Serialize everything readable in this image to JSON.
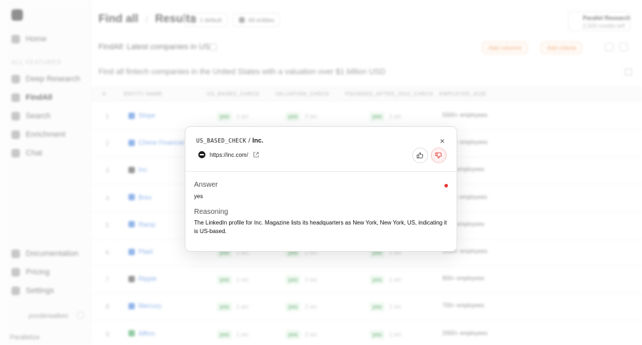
{
  "sidebar": {
    "items_top": [
      {
        "label": "Home"
      }
    ],
    "section_label": "ALL FEATURES",
    "items": [
      {
        "label": "Deep Research"
      },
      {
        "label": "FindAll"
      },
      {
        "label": "Search"
      },
      {
        "label": "Enrichment"
      },
      {
        "label": "Chat"
      }
    ],
    "bottom_items": [
      {
        "label": "Documentation"
      },
      {
        "label": "Pricing"
      },
      {
        "label": "Settings"
      }
    ],
    "user": "ponderwalken",
    "workspace": "Parallelize"
  },
  "header": {
    "breadcrumb_root": "Find all",
    "breadcrumb_separator": "/",
    "breadcrumb_current": "Results",
    "chip_1": "1 default",
    "chip_2": "All entities",
    "credits_title": "Parallel Research",
    "credits_subtitle": "2,500 credits left"
  },
  "toolbar": {
    "subtitle": "FindAll: Latest companies in US",
    "btn_1": "Add columns",
    "btn_2": "Add criteria"
  },
  "query": "Find all fintech companies in the United States with a valuation over $1 billion USD",
  "table": {
    "headers": [
      "#",
      "ENTITY NAME",
      "US_BASED_CHECK",
      "VALUATION_CHECK",
      "FOUNDED_AFTER_2010_CHECK",
      "EMPLOYEE_SIZE"
    ],
    "rows": [
      {
        "num": "1",
        "entity": "Stripe",
        "c1": "yes",
        "c1n": "1 src",
        "c2": "yes",
        "c2n": "2 src",
        "c3": "yes",
        "c3n": "1 src",
        "size": "5000+ employees"
      },
      {
        "num": "2",
        "entity": "Chime Financial",
        "c1": "yes",
        "c1n": "1 src",
        "c2": "yes",
        "c2n": "2 src",
        "c3": "yes",
        "c3n": "1 src",
        "size": "1200+ employees"
      },
      {
        "num": "3",
        "entity": "Inc.",
        "c1": "yes",
        "c1n": "1 src",
        "c2": "yes",
        "c2n": "1 src",
        "c3": "yes",
        "c3n": "1 src",
        "size": "400+ employees"
      },
      {
        "num": "4",
        "entity": "Brex",
        "c1": "yes",
        "c1n": "1 src",
        "c2": "yes",
        "c2n": "2 src",
        "c3": "yes",
        "c3n": "1 src",
        "size": "1100+ employees"
      },
      {
        "num": "5",
        "entity": "Ramp",
        "c1": "yes",
        "c1n": "1 src",
        "c2": "yes",
        "c2n": "2 src",
        "c3": "yes",
        "c3n": "1 src",
        "size": "800+ employees"
      },
      {
        "num": "6",
        "entity": "Plaid",
        "c1": "yes",
        "c1n": "1 src",
        "c2": "yes",
        "c2n": "2 src",
        "c3": "yes",
        "c3n": "1 src",
        "size": "1000+ employees"
      },
      {
        "num": "7",
        "entity": "Ripple",
        "c1": "yes",
        "c1n": "1 src",
        "c2": "yes",
        "c2n": "2 src",
        "c3": "yes",
        "c3n": "1 src",
        "size": "900+ employees"
      },
      {
        "num": "8",
        "entity": "Mercury",
        "c1": "yes",
        "c1n": "1 src",
        "c2": "yes",
        "c2n": "2 src",
        "c3": "yes",
        "c3n": "1 src",
        "size": "700+ employees"
      },
      {
        "num": "9",
        "entity": "Affirm",
        "c1": "yes",
        "c1n": "1 src",
        "c2": "yes",
        "c2n": "2 src",
        "c3": "yes",
        "c3n": "1 src",
        "size": "2000+ employees"
      }
    ]
  },
  "modal": {
    "field": "US_BASED_CHECK",
    "separator": "/",
    "entity": "Inc.",
    "url": "https://inc.com/",
    "close_icon": "×",
    "answer_label": "Answer",
    "answer_value": "yes",
    "reasoning_label": "Reasoning",
    "reasoning_text": "The LinkedIn profile for Inc. Magazine lists its headquarters as New York, New York, US, indicating it is US-based."
  },
  "colors": {
    "accent_red": "#e53935",
    "link_blue": "#3b7bd9",
    "yes_green": "#2e8a45"
  }
}
